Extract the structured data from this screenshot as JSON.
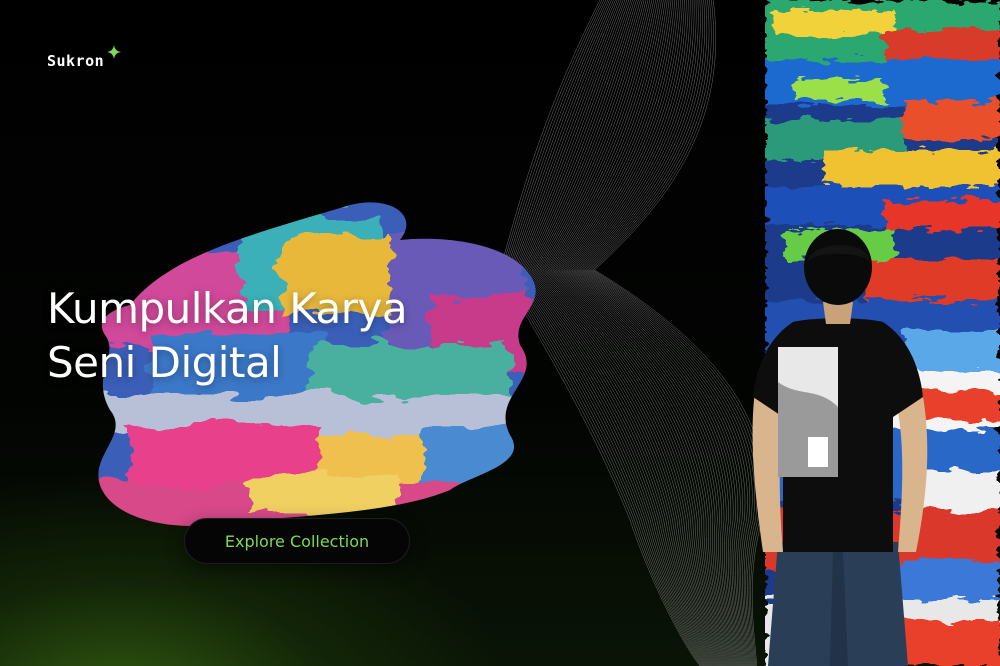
{
  "brand": {
    "name": "Sukron",
    "icon": "sparkle-icon",
    "accent_color": "#7ed957"
  },
  "hero": {
    "title_line1": "Kumpulkan Karya",
    "title_line2": "Seni Digital"
  },
  "cta": {
    "label": "Explore Collection",
    "text_color": "#7ed957"
  }
}
